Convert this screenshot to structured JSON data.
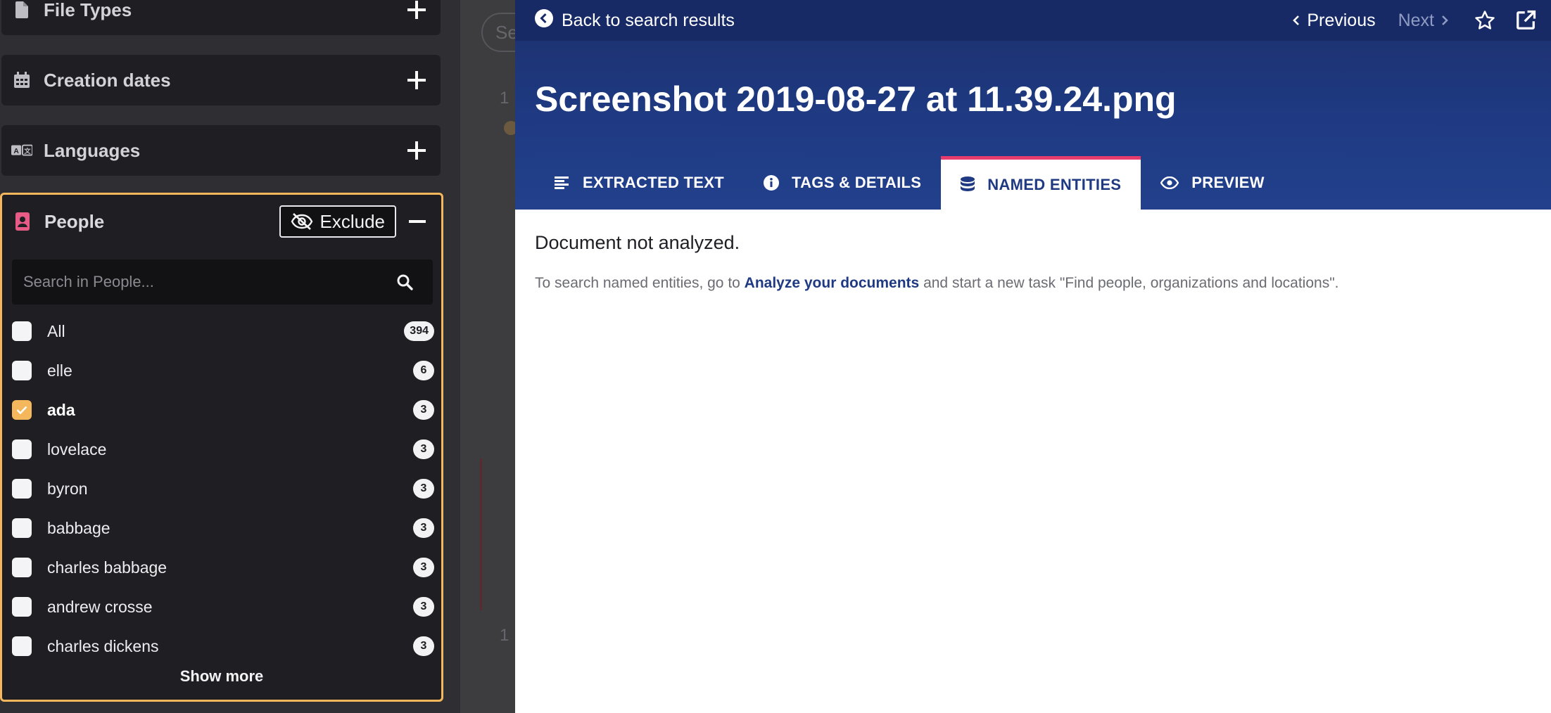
{
  "sidebar": {
    "facets": [
      {
        "label": "File Types",
        "icon": "file-icon"
      },
      {
        "label": "Creation dates",
        "icon": "calendar-icon"
      },
      {
        "label": "Languages",
        "icon": "language-icon"
      }
    ],
    "people": {
      "title": "People",
      "exclude_label": "Exclude",
      "search_placeholder": "Search in People...",
      "items": [
        {
          "name": "All",
          "count": "394",
          "checked": false
        },
        {
          "name": "elle",
          "count": "6",
          "checked": false
        },
        {
          "name": "ada",
          "count": "3",
          "checked": true
        },
        {
          "name": "lovelace",
          "count": "3",
          "checked": false
        },
        {
          "name": "byron",
          "count": "3",
          "checked": false
        },
        {
          "name": "babbage",
          "count": "3",
          "checked": false
        },
        {
          "name": "charles babbage",
          "count": "3",
          "checked": false
        },
        {
          "name": "andrew crosse",
          "count": "3",
          "checked": false
        },
        {
          "name": "charles dickens",
          "count": "3",
          "checked": false
        }
      ],
      "show_more": "Show more",
      "accent_color": "#f5b75b"
    }
  },
  "middle": {
    "search_fragment": "Se",
    "row_number_1": "1",
    "row_number_2": "1"
  },
  "document": {
    "back_label": "Back to search results",
    "previous_label": "Previous",
    "next_label": "Next",
    "title": "Screenshot 2019-08-27 at 11.39.24.png",
    "tabs": [
      {
        "label": "EXTRACTED TEXT",
        "icon": "text-lines-icon",
        "active": false
      },
      {
        "label": "TAGS & DETAILS",
        "icon": "info-icon",
        "active": false
      },
      {
        "label": "NAMED ENTITIES",
        "icon": "database-icon",
        "active": true
      },
      {
        "label": "PREVIEW",
        "icon": "eye-icon",
        "active": false
      }
    ],
    "status": "Document not analyzed.",
    "hint_prefix": "To search named entities, go to ",
    "hint_link": "Analyze your documents",
    "hint_suffix": " and start a new task \"Find people, organizations and locations\".",
    "header_color": "#1f3a82",
    "active_tab_accent": "#e63c6d"
  }
}
